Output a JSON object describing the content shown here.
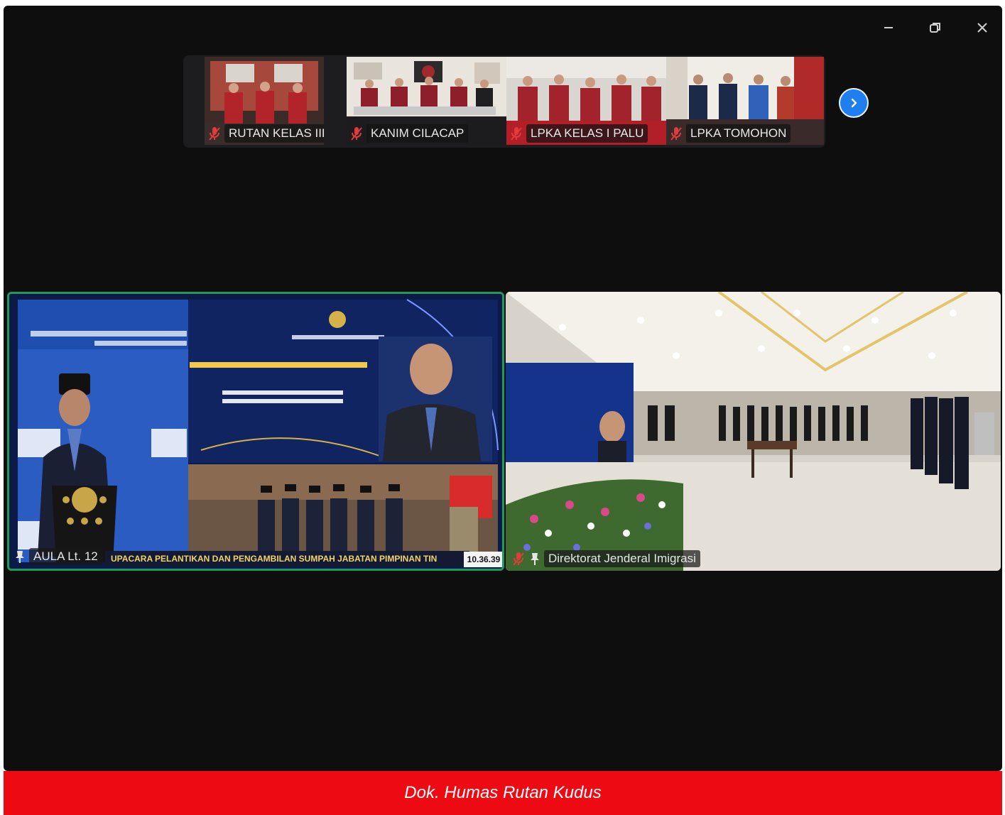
{
  "window": {
    "controls": {
      "minimize_icon": "minimize-icon",
      "restore_icon": "restore-icon",
      "close_icon": "close-icon"
    }
  },
  "participants_strip": {
    "thumbnails": [
      {
        "label": "RUTAN KELAS IIB KU...",
        "muted": true
      },
      {
        "label": "KANIM CILACAP",
        "muted": true
      },
      {
        "label": "LPKA KELAS I PALU",
        "muted": true
      },
      {
        "label": "LPKA TOMOHON",
        "muted": true
      }
    ],
    "next_icon": "chevron-right-icon"
  },
  "main_tiles": {
    "left": {
      "name": "AULA Lt. 12",
      "ticker": "UPACARA PELANTIKAN DAN PENGAMBILAN SUMPAH JABATAN PIMPINAN TIN",
      "clock": "10.36.39",
      "speaking": true
    },
    "right": {
      "name": "Direktorat Jenderal Imigrasi",
      "muted": true
    }
  },
  "caption": "Dok. Humas Rutan Kudus",
  "colors": {
    "window_bg": "#0e0e0f",
    "active_speaker_border": "#1f9a5e",
    "caption_bg": "#ee0a12",
    "next_button": "#1f7ef0"
  }
}
